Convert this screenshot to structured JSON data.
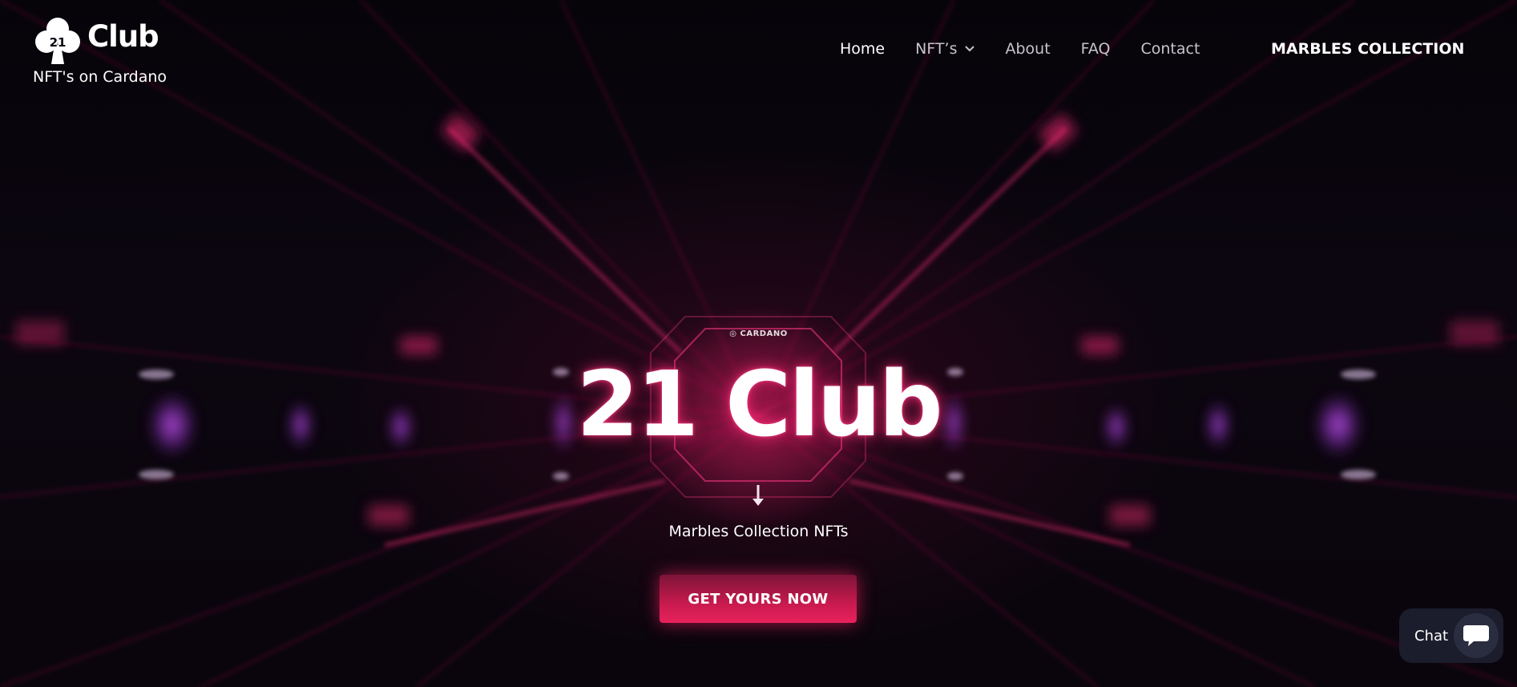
{
  "header": {
    "logo_text": "Club",
    "logo_badge": "21",
    "tagline": "NFT's on Cardano",
    "nav": [
      {
        "label": "Home"
      },
      {
        "label": "NFT’s"
      },
      {
        "label": "About"
      },
      {
        "label": "FAQ"
      },
      {
        "label": "Contact"
      }
    ],
    "cta_label": "MARBLES COLLECTION"
  },
  "hero": {
    "chain_badge": "CARDANO",
    "title": "21 Club",
    "subtitle": "Marbles Collection NFTs",
    "button_label": "GET YOURS NOW"
  },
  "chat": {
    "label": "Chat"
  },
  "colors": {
    "accent": "#e8225c",
    "background": "#07050c",
    "chat_bg": "#1b1c2c"
  }
}
